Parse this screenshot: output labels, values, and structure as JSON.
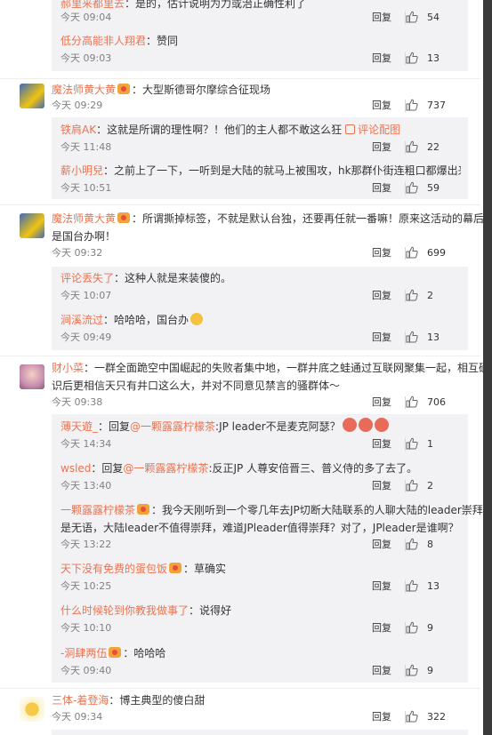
{
  "labels": {
    "reply": "回复"
  },
  "colors": {
    "username": "#eb7350",
    "sub_bg": "#f2f2f5",
    "meta": "#808080",
    "scrollbar": "#3a3a3a"
  },
  "icons": {
    "like": "thumbs-up-icon",
    "vip": "vip-badge-icon",
    "image": "image-icon"
  },
  "comments": [
    {
      "user": "郝里来都里去",
      "text": "：是的，估计说明为力或治正确性利了",
      "time": "今天 09:04",
      "likes": "54"
    },
    {
      "user": "低分高能非人翔君",
      "text": "：赞同",
      "time": "今天 09:03",
      "likes": "13"
    },
    {
      "user": "魔法师黄大黄",
      "text": "：大型斯德哥尔摩综合征现场",
      "time": "今天 09:29",
      "likes": "737"
    },
    {
      "user": "铁肩AK",
      "text": "：这就是所谓的理性啊？！他们的主人都不敢这么狂",
      "link": "评论配图",
      "time": "今天 11:48",
      "likes": "22"
    },
    {
      "user": "薪小明兒",
      "text": "：之前上了一下，一听到是大陆的就马上被围攻，hk那群仆街连粗口都爆出来了",
      "time": "今天 10:51",
      "likes": "59"
    },
    {
      "user": "魔法师黄大黄",
      "text1": "：所谓撕掉标签，不就是默认台独，还要再任就一番嘛！原来这活动的幕后主持",
      "text2": "是国台办啊！",
      "time": "今天 09:32",
      "likes": "699"
    },
    {
      "user": "评论丢失了",
      "text": "：这种人就是来装傻的。",
      "time": "今天 10:07",
      "likes": "2"
    },
    {
      "user": "涧溪流过",
      "text": "：哈哈哈，国台办",
      "time": "今天 09:49",
      "likes": "13"
    },
    {
      "user": "财小菜",
      "text1": "：一群全面跪空中国崛起的失败者集中地，一群井底之蛙通过互联网聚集一起，相互确认共",
      "text2": "识后更相信天只有井口这么大，并对不同意见禁言的骚群体～",
      "time": "今天 09:38",
      "likes": "706"
    },
    {
      "user": "薄天遊_",
      "text": "：回复",
      "mention": "@一颗露露柠檬茶",
      "text_after": ":JP leader不是麦克阿瑟？",
      "time": "今天 14:34",
      "likes": "1"
    },
    {
      "user": "wsled",
      "text": "：回复",
      "mention": "@一颗露露柠檬茶",
      "text_after": ":反正JP 人尊安倍晋三、普义侍的多了去了。",
      "time": "今天 13:40",
      "likes": "2"
    },
    {
      "user": "一颗露露柠檬茶",
      "text1": "：我今天刚听到一个零几年去JP切断大陆联系的人聊大陆的leader崇拜，真",
      "text2": "是无语，大陆leader不值得崇拜，难道JPleader值得崇拜？对了，JPleader是谁啊？",
      "time": "今天 13:22",
      "likes": "8"
    },
    {
      "user": "天下没有免费的蛋包饭",
      "text": "：草确实",
      "time": "今天 10:25",
      "likes": "13"
    },
    {
      "user": "什么时候轮到你教我做事了",
      "text": "：说得好",
      "time": "今天 10:10",
      "likes": "9"
    },
    {
      "user": "-洞肆两伍",
      "text": "：哈哈哈",
      "time": "今天 09:40",
      "likes": "9"
    },
    {
      "user": "三体-着登海",
      "text": "：博主典型的傻白甜",
      "time": "今天 09:34",
      "likes": "322"
    }
  ]
}
